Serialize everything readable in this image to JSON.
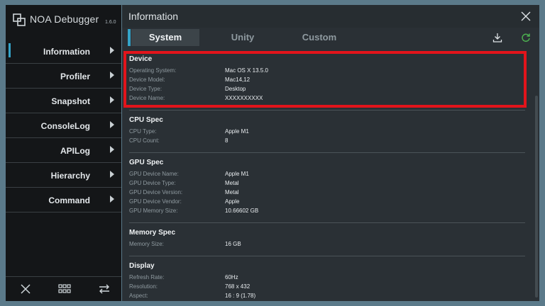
{
  "app": {
    "name": "NOA Debugger",
    "version": "1.6.0"
  },
  "sidebar": {
    "items": [
      {
        "label": "Information",
        "active": true
      },
      {
        "label": "Profiler"
      },
      {
        "label": "Snapshot"
      },
      {
        "label": "ConsoleLog"
      },
      {
        "label": "APILog"
      },
      {
        "label": "Hierarchy"
      },
      {
        "label": "Command"
      }
    ],
    "bottom": [
      "close-icon",
      "grid-icon",
      "swap-arrows-icon"
    ]
  },
  "header": {
    "title": "Information"
  },
  "tabs": [
    {
      "label": "System",
      "active": true
    },
    {
      "label": "Unity"
    },
    {
      "label": "Custom"
    }
  ],
  "colors": {
    "accent": "#34a3c8",
    "highlight": "#e2141b",
    "refresh": "#4caf50"
  },
  "sections": {
    "device": {
      "title": "Device",
      "rows": [
        {
          "k": "Operating System:",
          "v": "Mac OS X 13.5.0"
        },
        {
          "k": "Device Model:",
          "v": "Mac14,12"
        },
        {
          "k": "Device Type:",
          "v": "Desktop"
        },
        {
          "k": "Device Name:",
          "v": "XXXXXXXXXX"
        }
      ]
    },
    "cpu": {
      "title": "CPU Spec",
      "rows": [
        {
          "k": "CPU Type:",
          "v": "Apple M1"
        },
        {
          "k": "CPU Count:",
          "v": "8"
        }
      ]
    },
    "gpu": {
      "title": "GPU Spec",
      "rows": [
        {
          "k": "GPU Device Name:",
          "v": "Apple M1"
        },
        {
          "k": "GPU Device Type:",
          "v": "Metal"
        },
        {
          "k": "GPU Device Version:",
          "v": "Metal"
        },
        {
          "k": "GPU Device Vendor:",
          "v": "Apple"
        },
        {
          "k": "GPU Memory Size:",
          "v": "10.66602 GB"
        }
      ]
    },
    "memory": {
      "title": "Memory Spec",
      "rows": [
        {
          "k": "Memory Size:",
          "v": "16 GB"
        }
      ]
    },
    "display": {
      "title": "Display",
      "rows": [
        {
          "k": "Refresh Rate:",
          "v": "60Hz"
        },
        {
          "k": "Resolution:",
          "v": "768 x 432"
        },
        {
          "k": "Aspect:",
          "v": "16 : 9 (1.78)"
        }
      ]
    }
  }
}
